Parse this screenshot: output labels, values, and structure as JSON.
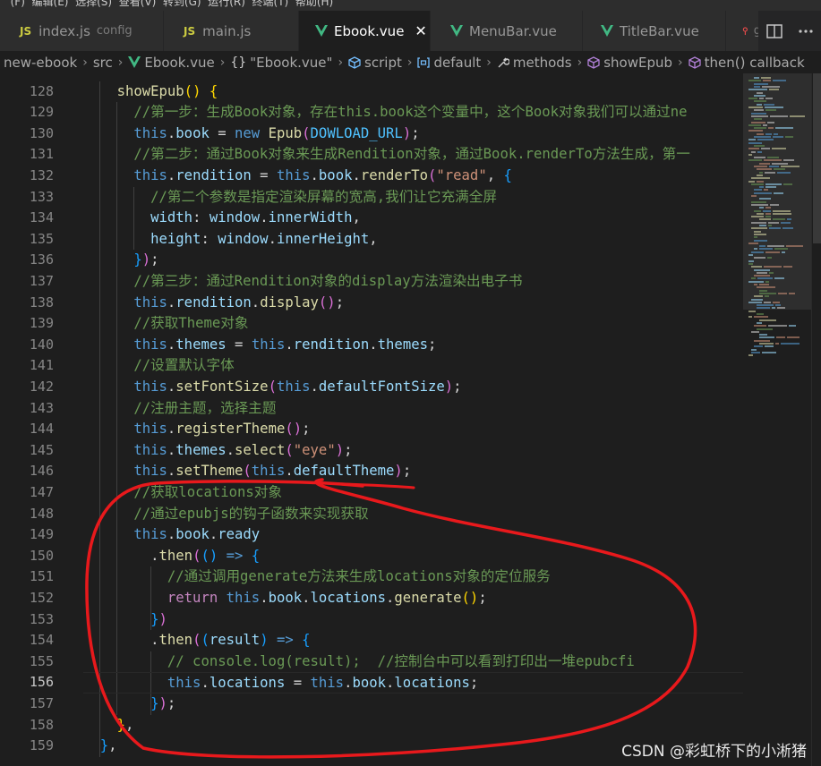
{
  "menu_strip": "  (F)  编辑(E)  选择(S)  查看(V)  转到(G)  运行(R)  终端(T)  帮助(H)",
  "tabs": [
    {
      "icon": "js",
      "label": "index.js",
      "desc": "config",
      "active": false
    },
    {
      "icon": "js",
      "label": "main.js",
      "desc": "",
      "active": false
    },
    {
      "icon": "vue",
      "label": "Ebook.vue",
      "desc": "",
      "active": true
    },
    {
      "icon": "vue",
      "label": "MenuBar.vue",
      "desc": "",
      "active": false
    },
    {
      "icon": "vue",
      "label": "TitleBar.vue",
      "desc": "",
      "active": false
    }
  ],
  "tab_overflow_label": "g",
  "tab_close_glyph": "✕",
  "breadcrumbs": [
    "new-ebook",
    "src",
    "Ebook.vue",
    "\"Ebook.vue\"",
    "script",
    "default",
    "methods",
    "showEpub",
    "then() callback"
  ],
  "breadcrumb_icons": [
    "",
    "",
    "vue",
    "{}",
    "cube",
    "bracket",
    "wrench",
    "cube",
    "cube"
  ],
  "line_numbers": [
    "128",
    "129",
    "130",
    "131",
    "132",
    "133",
    "134",
    "135",
    "136",
    "137",
    "138",
    "139",
    "140",
    "141",
    "142",
    "143",
    "144",
    "145",
    "146",
    "147",
    "148",
    "149",
    "150",
    "151",
    "152",
    "153",
    "154",
    "155",
    "156",
    "157",
    "158",
    "159"
  ],
  "current_line": "156",
  "code_lines": [
    [
      [
        "",
        "    "
      ],
      [
        "fn",
        "showEpub"
      ],
      [
        "br1",
        "("
      ],
      [
        "br1",
        ")"
      ],
      [
        "punc",
        " "
      ],
      [
        "br1",
        "{"
      ]
    ],
    [
      [
        "",
        "      "
      ],
      [
        "com",
        "//第一步：生成Book对象，存在this.book这个变量中，这个Book对象我们可以通过ne"
      ]
    ],
    [
      [
        "",
        "      "
      ],
      [
        "kw",
        "this"
      ],
      [
        "punc",
        "."
      ],
      [
        "prop",
        "book"
      ],
      [
        "punc",
        " = "
      ],
      [
        "kw",
        "new"
      ],
      [
        "punc",
        " "
      ],
      [
        "fn",
        "Epub"
      ],
      [
        "br2",
        "("
      ],
      [
        "const",
        "DOWLOAD_URL"
      ],
      [
        "br2",
        ")"
      ],
      [
        "punc",
        ";"
      ]
    ],
    [
      [
        "",
        "      "
      ],
      [
        "com",
        "//第二步：通过Book对象来生成Rendition对象，通过Book.renderTo方法生成，第一"
      ]
    ],
    [
      [
        "",
        "      "
      ],
      [
        "kw",
        "this"
      ],
      [
        "punc",
        "."
      ],
      [
        "prop",
        "rendition"
      ],
      [
        "punc",
        " = "
      ],
      [
        "kw",
        "this"
      ],
      [
        "punc",
        "."
      ],
      [
        "prop",
        "book"
      ],
      [
        "punc",
        "."
      ],
      [
        "fn",
        "renderTo"
      ],
      [
        "br2",
        "("
      ],
      [
        "str",
        "\"read\""
      ],
      [
        "punc",
        ", "
      ],
      [
        "br3",
        "{"
      ]
    ],
    [
      [
        "",
        "        "
      ],
      [
        "com",
        "//第二个参数是指定渲染屏幕的宽高,我们让它充满全屏"
      ]
    ],
    [
      [
        "",
        "        "
      ],
      [
        "prop",
        "width"
      ],
      [
        "punc",
        ": "
      ],
      [
        "prop",
        "window"
      ],
      [
        "punc",
        "."
      ],
      [
        "prop",
        "innerWidth"
      ],
      [
        "punc",
        ","
      ]
    ],
    [
      [
        "",
        "        "
      ],
      [
        "prop",
        "height"
      ],
      [
        "punc",
        ": "
      ],
      [
        "prop",
        "window"
      ],
      [
        "punc",
        "."
      ],
      [
        "prop",
        "innerHeight"
      ],
      [
        "punc",
        ","
      ]
    ],
    [
      [
        "",
        "      "
      ],
      [
        "br3",
        "}"
      ],
      [
        "br2",
        ")"
      ],
      [
        "punc",
        ";"
      ]
    ],
    [
      [
        "",
        "      "
      ],
      [
        "com",
        "//第三步：通过Rendition对象的display方法渲染出电子书"
      ]
    ],
    [
      [
        "",
        "      "
      ],
      [
        "kw",
        "this"
      ],
      [
        "punc",
        "."
      ],
      [
        "prop",
        "rendition"
      ],
      [
        "punc",
        "."
      ],
      [
        "fn",
        "display"
      ],
      [
        "br2",
        "("
      ],
      [
        "br2",
        ")"
      ],
      [
        "punc",
        ";"
      ]
    ],
    [
      [
        "",
        "      "
      ],
      [
        "com",
        "//获取Theme对象"
      ]
    ],
    [
      [
        "",
        "      "
      ],
      [
        "kw",
        "this"
      ],
      [
        "punc",
        "."
      ],
      [
        "prop",
        "themes"
      ],
      [
        "punc",
        " = "
      ],
      [
        "kw",
        "this"
      ],
      [
        "punc",
        "."
      ],
      [
        "prop",
        "rendition"
      ],
      [
        "punc",
        "."
      ],
      [
        "prop",
        "themes"
      ],
      [
        "punc",
        ";"
      ]
    ],
    [
      [
        "",
        "      "
      ],
      [
        "com",
        "//设置默认字体"
      ]
    ],
    [
      [
        "",
        "      "
      ],
      [
        "kw",
        "this"
      ],
      [
        "punc",
        "."
      ],
      [
        "fn",
        "setFontSize"
      ],
      [
        "br2",
        "("
      ],
      [
        "kw",
        "this"
      ],
      [
        "punc",
        "."
      ],
      [
        "prop",
        "defaultFontSize"
      ],
      [
        "br2",
        ")"
      ],
      [
        "punc",
        ";"
      ]
    ],
    [
      [
        "",
        "      "
      ],
      [
        "com",
        "//注册主题，选择主题"
      ]
    ],
    [
      [
        "",
        "      "
      ],
      [
        "kw",
        "this"
      ],
      [
        "punc",
        "."
      ],
      [
        "fn",
        "registerTheme"
      ],
      [
        "br2",
        "("
      ],
      [
        "br2",
        ")"
      ],
      [
        "punc",
        ";"
      ]
    ],
    [
      [
        "",
        "      "
      ],
      [
        "kw",
        "this"
      ],
      [
        "punc",
        "."
      ],
      [
        "prop",
        "themes"
      ],
      [
        "punc",
        "."
      ],
      [
        "fn",
        "select"
      ],
      [
        "br2",
        "("
      ],
      [
        "str",
        "\"eye\""
      ],
      [
        "br2",
        ")"
      ],
      [
        "punc",
        ";"
      ]
    ],
    [
      [
        "",
        "      "
      ],
      [
        "kw",
        "this"
      ],
      [
        "punc",
        "."
      ],
      [
        "fn",
        "setTheme"
      ],
      [
        "br2",
        "("
      ],
      [
        "kw",
        "this"
      ],
      [
        "punc",
        "."
      ],
      [
        "prop",
        "defaultTheme"
      ],
      [
        "br2",
        ")"
      ],
      [
        "punc",
        ";"
      ]
    ],
    [
      [
        "",
        "      "
      ],
      [
        "com",
        "//获取locations对象"
      ]
    ],
    [
      [
        "",
        "      "
      ],
      [
        "com",
        "//通过epubjs的钩子函数来实现获取"
      ]
    ],
    [
      [
        "",
        "      "
      ],
      [
        "kw",
        "this"
      ],
      [
        "punc",
        "."
      ],
      [
        "prop",
        "book"
      ],
      [
        "punc",
        "."
      ],
      [
        "prop",
        "ready"
      ]
    ],
    [
      [
        "",
        "        "
      ],
      [
        "punc",
        "."
      ],
      [
        "fn",
        "then"
      ],
      [
        "br2",
        "("
      ],
      [
        "br3",
        "("
      ],
      [
        "br3",
        ")"
      ],
      [
        "punc",
        " "
      ],
      [
        "kw",
        "=>"
      ],
      [
        "punc",
        " "
      ],
      [
        "br3",
        "{"
      ]
    ],
    [
      [
        "",
        "          "
      ],
      [
        "com",
        "//通过调用generate方法来生成locations对象的定位服务"
      ]
    ],
    [
      [
        "",
        "          "
      ],
      [
        "ctrl",
        "return"
      ],
      [
        "punc",
        " "
      ],
      [
        "kw",
        "this"
      ],
      [
        "punc",
        "."
      ],
      [
        "prop",
        "book"
      ],
      [
        "punc",
        "."
      ],
      [
        "prop",
        "locations"
      ],
      [
        "punc",
        "."
      ],
      [
        "fn",
        "generate"
      ],
      [
        "br1",
        "("
      ],
      [
        "br1",
        ")"
      ],
      [
        "punc",
        ";"
      ]
    ],
    [
      [
        "",
        "        "
      ],
      [
        "br3",
        "}"
      ],
      [
        "br2",
        ")"
      ]
    ],
    [
      [
        "",
        "        "
      ],
      [
        "punc",
        "."
      ],
      [
        "fn",
        "then"
      ],
      [
        "br2",
        "("
      ],
      [
        "br3",
        "("
      ],
      [
        "prop",
        "result"
      ],
      [
        "br3",
        ")"
      ],
      [
        "punc",
        " "
      ],
      [
        "kw",
        "=>"
      ],
      [
        "punc",
        " "
      ],
      [
        "br3",
        "{"
      ]
    ],
    [
      [
        "",
        "          "
      ],
      [
        "com",
        "// console.log(result);  //控制台中可以看到打印出一堆epubcfi"
      ]
    ],
    [
      [
        "",
        "          "
      ],
      [
        "kw",
        "this"
      ],
      [
        "punc",
        "."
      ],
      [
        "prop",
        "locations"
      ],
      [
        "punc",
        " = "
      ],
      [
        "kw",
        "this"
      ],
      [
        "punc",
        "."
      ],
      [
        "prop",
        "book"
      ],
      [
        "punc",
        "."
      ],
      [
        "prop",
        "locations"
      ],
      [
        "punc",
        ";"
      ]
    ],
    [
      [
        "",
        "        "
      ],
      [
        "br3",
        "}"
      ],
      [
        "br2",
        ")"
      ],
      [
        "punc",
        ";"
      ]
    ],
    [
      [
        "",
        "    "
      ],
      [
        "br1",
        "}"
      ],
      [
        "punc",
        ","
      ]
    ],
    [
      [
        "",
        "  "
      ],
      [
        "br3",
        "}"
      ],
      [
        "punc",
        ","
      ]
    ]
  ],
  "annotation_color": "#e8191c",
  "watermark": "CSDN @彩虹桥下的小淅猪"
}
